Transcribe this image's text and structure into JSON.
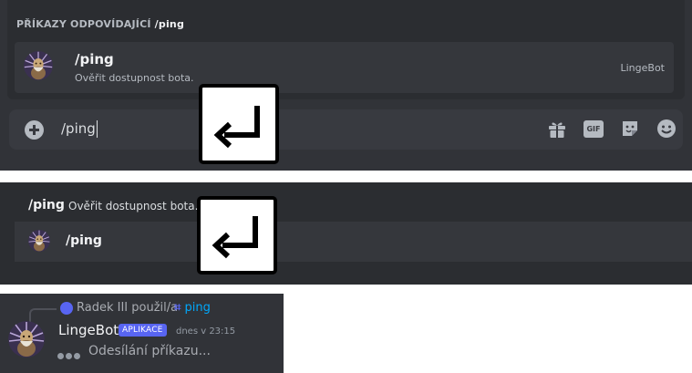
{
  "panel1": {
    "popup_header_prefix": "PŘÍKAZY ODPOVÍDAJÍCÍ",
    "popup_header_query": "/ping",
    "command": {
      "name": "/ping",
      "description": "Ověřit dostupnost bota.",
      "bot": "LingeBot"
    },
    "input_value": "/ping",
    "toolbar_icons": [
      "gift-icon",
      "gif-icon",
      "sticker-icon",
      "emoji-icon"
    ],
    "gif_label": "GIF"
  },
  "panel2": {
    "header_command": "/ping",
    "header_description": "Ověřit dostupnost bota.",
    "option_name": "/ping"
  },
  "panel3": {
    "reply_user": "Radek III použil/a",
    "reply_command": "ping",
    "author": "LingeBot",
    "badge": "APLIKACE",
    "timestamp": "dnes v 23:15",
    "status": "Odesílání příkazu..."
  },
  "colors": {
    "background": "#313338",
    "popup": "#2b2d31",
    "row_highlight": "#35373c",
    "blurple": "#5865f2",
    "link": "#00a8fc"
  }
}
